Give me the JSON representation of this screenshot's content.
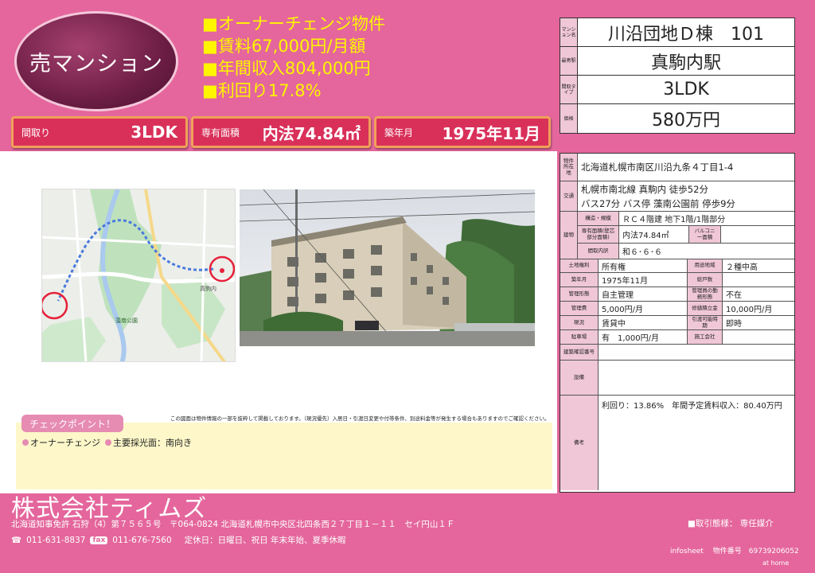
{
  "badge": "売マンション",
  "headlines": [
    "■オーナーチェンジ物件",
    "■賃料67,000円/月額",
    "■年間収入804,000円",
    "■利回り17.8%"
  ],
  "tags": [
    {
      "key": "間取り",
      "value": "3LDK"
    },
    {
      "key": "専有面積",
      "value": "内法74.84㎡"
    },
    {
      "key": "築年月",
      "value": "1975年11月"
    }
  ],
  "summary": [
    {
      "label": "マンション名",
      "value": "川沿団地Ｄ棟　101"
    },
    {
      "label": "最寄駅",
      "value": "真駒内駅"
    },
    {
      "label": "間取タイプ",
      "value": "3LDK"
    },
    {
      "label": "価格",
      "value": "580万円"
    }
  ],
  "info": {
    "location_label": "物件所在地",
    "location": "北海道札幌市南区川沿九条４丁目1-4",
    "transport_label": "交通",
    "transport_1": "札幌市南北線 真駒内 徒歩52分",
    "transport_2": "バス27分 バス停 藻南公園前 停歩9分",
    "building_label": "建物",
    "structure_label": "構造・規模",
    "structure": "ＲＣ４階建 地下1階/1階部分",
    "area_label": "専有面積(壁芯部分面積)",
    "area": "内法74.84㎡",
    "balcony_label": "バルコニー面積",
    "balcony": "",
    "layout_label": "間取内訳",
    "layout": "和６･６･６",
    "land_right_label": "土地権利",
    "land_right": "所有権",
    "zoning_label": "用途地域",
    "zoning": "２種中高",
    "built_label": "築年月",
    "built": "1975年11月",
    "total_units_label": "総戸数",
    "total_units": "",
    "management_label": "管理形態",
    "management": "自主管理",
    "manager_label": "管理員の勤務形態",
    "manager": "不在",
    "mgmt_fee_label": "管理費",
    "mgmt_fee": "5,000円/月",
    "repair_fund_label": "修繕積立金",
    "repair_fund": "10,000円/月",
    "status_label": "現況",
    "status": "賃貸中",
    "handover_label": "引渡可能時期",
    "handover": "即時",
    "parking_label": "駐車場",
    "parking": "有　1,000円/月",
    "builder_label": "施工会社",
    "builder": "",
    "confirm_label": "建築確認番号",
    "confirm": "",
    "facility_label": "設備",
    "facility": "",
    "remarks_label": "備考",
    "remarks": "利回り：13.86%　年間予定賃料収入：80.40万円"
  },
  "map_labels": [
    "真駒内",
    "藻南公園"
  ],
  "note": "この図面は物件情報の一部を抜粋して掲載しております。（現況優先）入居日・引渡日変更や付帯条件、別途料金等が発生する場合もありますのでご確認ください。",
  "check": {
    "title": "チェックポイント！",
    "items": [
      "オーナーチェンジ",
      "主要採光面：南向き"
    ]
  },
  "company": {
    "name": "株式会社ティムズ",
    "address": "北海道知事免許 石狩（4）第７５６５号　〒064-0824 北海道札幌市中央区北四条西２７丁目１－１１　セイ円山１Ｆ",
    "tel": "011-631-8837",
    "fax_badge": "fax",
    "fax": "011-676-7560",
    "holiday": "定休日：日曜日、祝日 年末年始、夏季休暇",
    "deal": "■取引態様：  専任媒介",
    "infosheet": "infosheet　 物件番号　69739206052",
    "athome": "at home"
  },
  "colors": {
    "pink": "#e4669c",
    "yellow_text": "#fff600",
    "tag_red": "#d9305a",
    "oval": "#6d1e45",
    "label_pink": "#f0c7d7",
    "check_bg": "#fdf7c9"
  }
}
